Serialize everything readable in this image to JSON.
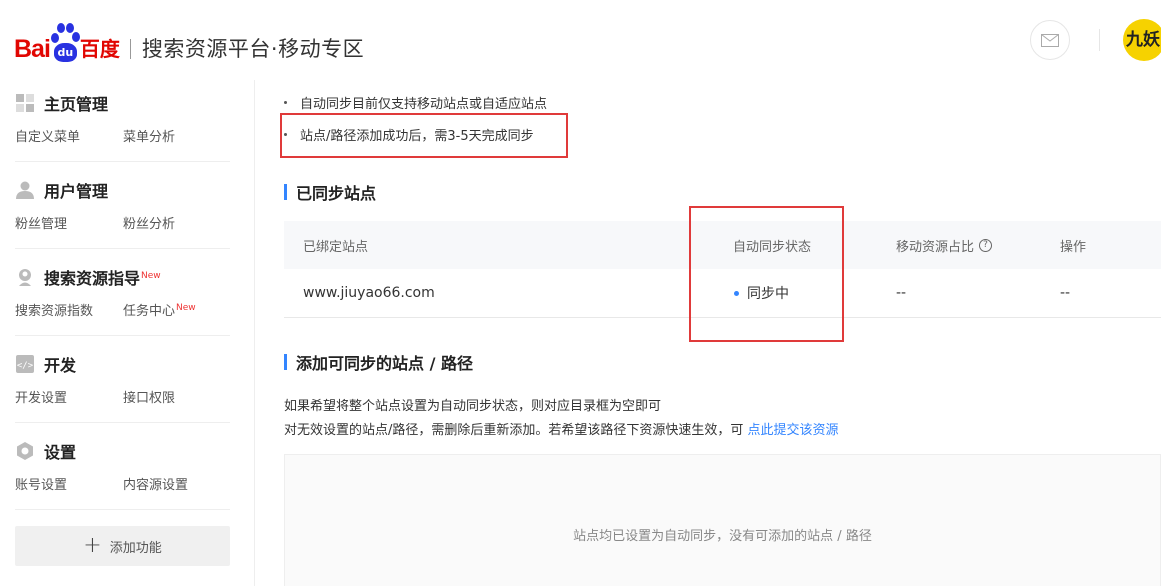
{
  "header": {
    "logo": {
      "bai": "Bai",
      "du": "百度",
      "paw_text": "du"
    },
    "title": "搜索资源平台·移动专区",
    "avatar_text": "九妖"
  },
  "sidebar": {
    "groups": [
      {
        "icon": "home-grid-icon",
        "title": "主页管理",
        "new": "",
        "links": [
          {
            "label": "自定义菜单",
            "new": ""
          },
          {
            "label": "菜单分析",
            "new": ""
          }
        ]
      },
      {
        "icon": "user-icon",
        "title": "用户管理",
        "new": "",
        "links": [
          {
            "label": "粉丝管理",
            "new": ""
          },
          {
            "label": "粉丝分析",
            "new": ""
          }
        ]
      },
      {
        "icon": "search-user-icon",
        "title": "搜索资源指导",
        "new": "New",
        "links": [
          {
            "label": "搜索资源指数",
            "new": ""
          },
          {
            "label": "任务中心",
            "new": "New"
          }
        ]
      },
      {
        "icon": "code-icon",
        "title": "开发",
        "new": "",
        "links": [
          {
            "label": "开发设置",
            "new": ""
          },
          {
            "label": "接口权限",
            "new": ""
          }
        ]
      },
      {
        "icon": "settings-icon",
        "title": "设置",
        "new": "",
        "links": [
          {
            "label": "账号设置",
            "new": ""
          },
          {
            "label": "内容源设置",
            "new": ""
          }
        ]
      }
    ],
    "add_function": "添加功能"
  },
  "main": {
    "notes": [
      "自动同步目前仅支持移动站点或自适应站点",
      "站点/路径添加成功后，需3-5天完成同步"
    ],
    "synced_section": {
      "title": "已同步站点",
      "columns": [
        "已绑定站点",
        "自动同步状态",
        "移动资源占比",
        "操作"
      ],
      "rows": [
        {
          "site": "www.jiuyao66.com",
          "status": "同步中",
          "ratio": "--",
          "action": "--"
        }
      ]
    },
    "add_section": {
      "title": "添加可同步的站点 / 路径",
      "desc_line1": "如果希望将整个站点设置为自动同步状态，则对应目录框为空即可",
      "desc_line2": "对无效设置的站点/路径，需删除后重新添加。若希望该路径下资源快速生效，可",
      "desc_link": "点此提交该资源",
      "empty_text": "站点均已设置为自动同步，没有可添加的站点 / 路径"
    }
  }
}
